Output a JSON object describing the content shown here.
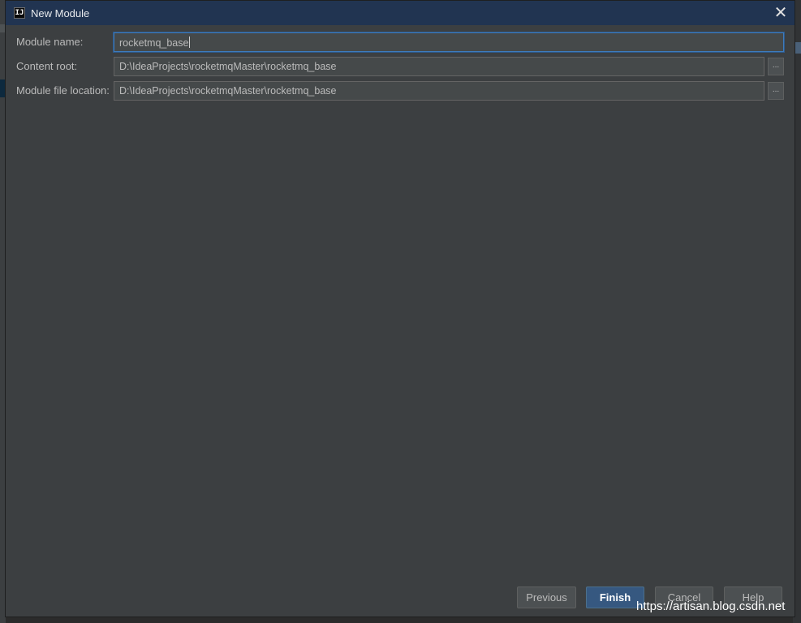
{
  "window": {
    "title": "New Module",
    "icon": "intellij-idea-icon",
    "close_glyph": "✕"
  },
  "form": {
    "module_name": {
      "label": "Module name:",
      "value": "rocketmq_base"
    },
    "content_root": {
      "label": "Content root:",
      "value": "D:\\IdeaProjects\\rocketmqMaster\\rocketmq_base",
      "browse_label": "..."
    },
    "module_file_location": {
      "label": "Module file location:",
      "value": "D:\\IdeaProjects\\rocketmqMaster\\rocketmq_base",
      "browse_label": "..."
    }
  },
  "buttons": {
    "previous": "Previous",
    "finish": "Finish",
    "cancel": "Cancel",
    "help": "Help"
  },
  "watermark": "https://artisan.blog.csdn.net",
  "colors": {
    "titlebar": "#213451",
    "dialog_bg": "#3c3f41",
    "field_bg": "#45494a",
    "focus_border": "#3d7bbd",
    "default_button": "#365880"
  }
}
